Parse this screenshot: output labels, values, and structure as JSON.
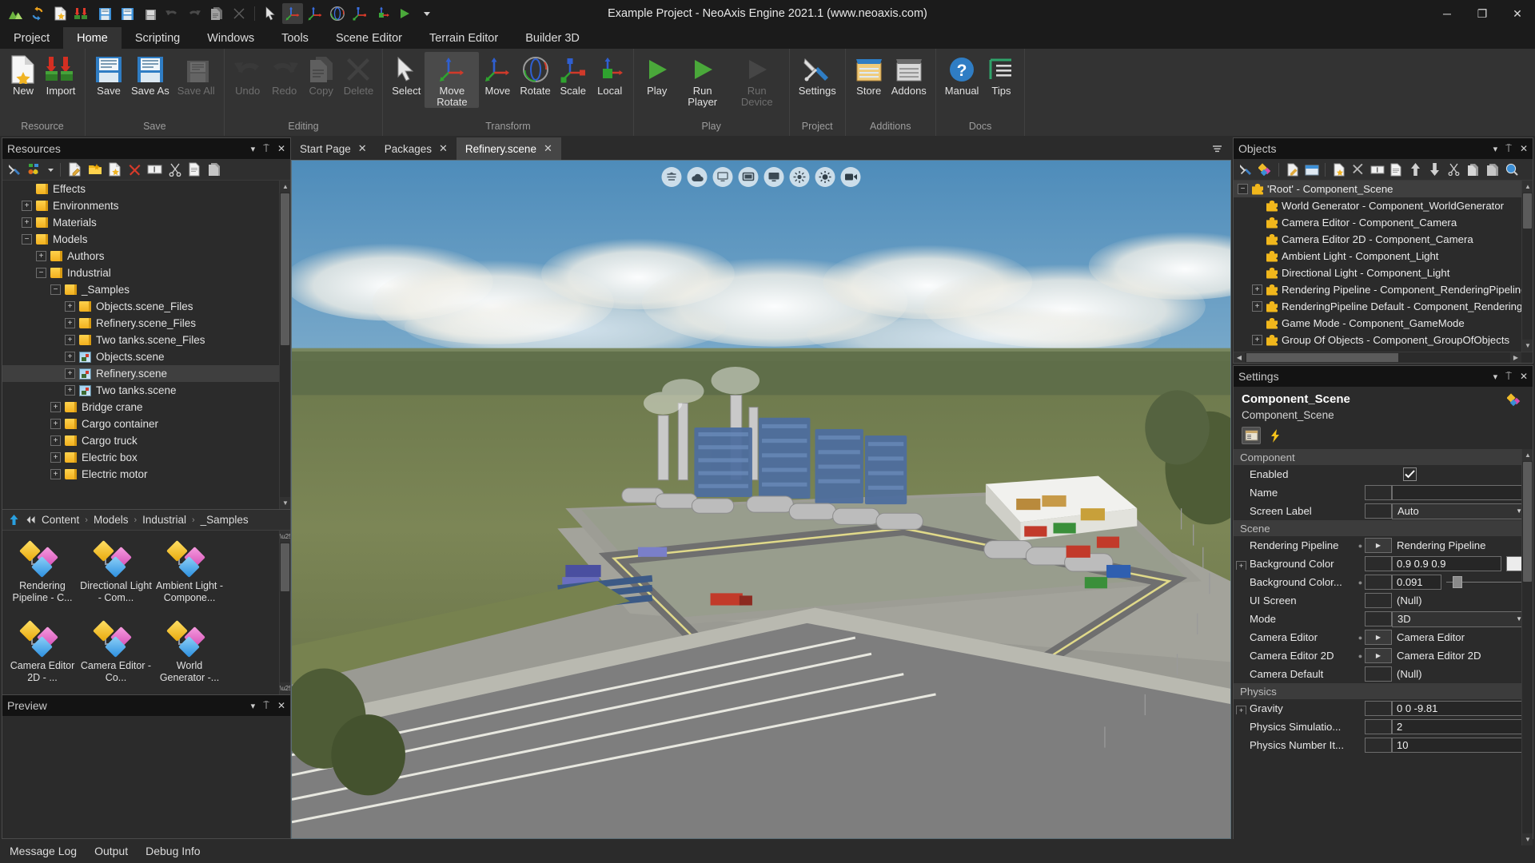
{
  "window": {
    "title": "Example Project - NeoAxis Engine 2021.1 (www.neoaxis.com)",
    "minimize": "─",
    "maximize": "❐",
    "close": "✕"
  },
  "quick_access": [
    {
      "name": "landscape-icon"
    },
    {
      "name": "refresh-icon"
    },
    {
      "name": "new-document-icon"
    },
    {
      "name": "import-icon"
    },
    {
      "name": "save-icon"
    },
    {
      "name": "save-as-icon"
    },
    {
      "name": "save-all-icon"
    },
    {
      "name": "undo-icon"
    },
    {
      "name": "redo-icon"
    },
    {
      "name": "copy-icon"
    },
    {
      "name": "delete-icon"
    },
    {
      "name": "select-cursor-icon"
    },
    {
      "name": "move-rotate-gizmo-icon"
    },
    {
      "name": "move-gizmo-icon"
    },
    {
      "name": "rotate-gizmo-icon"
    },
    {
      "name": "scale-gizmo-icon"
    },
    {
      "name": "local-gizmo-icon"
    },
    {
      "name": "play-icon"
    },
    {
      "name": "run-player-icon"
    },
    {
      "name": "wrench-icon"
    },
    {
      "name": "overflow-icon"
    }
  ],
  "ribbon": {
    "tabs": [
      {
        "label": "Project",
        "active": false
      },
      {
        "label": "Home",
        "active": true
      },
      {
        "label": "Scripting",
        "active": false
      },
      {
        "label": "Windows",
        "active": false
      },
      {
        "label": "Tools",
        "active": false
      },
      {
        "label": "Scene Editor",
        "active": false
      },
      {
        "label": "Terrain Editor",
        "active": false
      },
      {
        "label": "Builder 3D",
        "active": false
      }
    ],
    "groups": [
      {
        "label": "Resource",
        "items": [
          {
            "label": "New",
            "icon": "new-document-icon",
            "disabled": false,
            "selected": false
          },
          {
            "label": "Import",
            "icon": "import-icon",
            "disabled": false,
            "selected": false
          }
        ]
      },
      {
        "label": "Save",
        "items": [
          {
            "label": "Save",
            "icon": "save-icon",
            "disabled": false,
            "selected": false
          },
          {
            "label": "Save As",
            "icon": "save-as-icon",
            "disabled": false,
            "selected": false
          },
          {
            "label": "Save All",
            "icon": "save-all-icon",
            "disabled": true,
            "selected": false
          }
        ]
      },
      {
        "label": "Editing",
        "items": [
          {
            "label": "Undo",
            "icon": "undo-icon",
            "disabled": true,
            "selected": false
          },
          {
            "label": "Redo",
            "icon": "redo-icon",
            "disabled": true,
            "selected": false
          },
          {
            "label": "Copy",
            "icon": "copy-icon",
            "disabled": true,
            "selected": false
          },
          {
            "label": "Delete",
            "icon": "delete-icon",
            "disabled": true,
            "selected": false
          }
        ]
      },
      {
        "label": "Transform",
        "items": [
          {
            "label": "Select",
            "icon": "select-cursor-icon",
            "disabled": false,
            "selected": false
          },
          {
            "label": "Move Rotate",
            "icon": "move-rotate-gizmo-icon",
            "disabled": false,
            "selected": true
          },
          {
            "label": "Move",
            "icon": "move-gizmo-icon",
            "disabled": false,
            "selected": false
          },
          {
            "label": "Rotate",
            "icon": "rotate-gizmo-icon",
            "disabled": false,
            "selected": false
          },
          {
            "label": "Scale",
            "icon": "scale-gizmo-icon",
            "disabled": false,
            "selected": false
          },
          {
            "label": "Local",
            "icon": "local-gizmo-icon",
            "disabled": false,
            "selected": false
          }
        ]
      },
      {
        "label": "Play",
        "items": [
          {
            "label": "Play",
            "icon": "play-icon",
            "disabled": false,
            "selected": false
          },
          {
            "label": "Run Player",
            "icon": "run-player-icon",
            "disabled": false,
            "selected": false
          },
          {
            "label": "Run Device",
            "icon": "run-device-icon",
            "disabled": true,
            "selected": false
          }
        ]
      },
      {
        "label": "Project",
        "items": [
          {
            "label": "Settings",
            "icon": "wrench-icon",
            "disabled": false,
            "selected": false
          }
        ]
      },
      {
        "label": "Additions",
        "items": [
          {
            "label": "Store",
            "icon": "store-icon",
            "disabled": false,
            "selected": false
          },
          {
            "label": "Addons",
            "icon": "addons-icon",
            "disabled": false,
            "selected": false
          }
        ]
      },
      {
        "label": "Docs",
        "items": [
          {
            "label": "Manual",
            "icon": "help-icon",
            "disabled": false,
            "selected": false
          },
          {
            "label": "Tips",
            "icon": "tips-icon",
            "disabled": false,
            "selected": false
          }
        ]
      }
    ]
  },
  "resources_panel": {
    "title": "Resources",
    "toolbar": [
      {
        "name": "wrench-icon"
      },
      {
        "name": "filter-shapes-icon"
      },
      {
        "name": "dropdown-arrow-icon"
      },
      {
        "name": "edit-document-icon"
      },
      {
        "name": "new-folder-icon"
      },
      {
        "name": "new-resource-icon"
      },
      {
        "name": "delete-red-x-icon"
      },
      {
        "name": "rename-icon"
      },
      {
        "name": "cut-scissors-icon"
      },
      {
        "name": "copy-icon"
      },
      {
        "name": "paste-icon"
      }
    ],
    "tree": [
      {
        "label": "Effects",
        "indent": 1,
        "expander": "",
        "icon": "folder",
        "selected": false
      },
      {
        "label": "Environments",
        "indent": 1,
        "expander": "+",
        "icon": "folder",
        "selected": false
      },
      {
        "label": "Materials",
        "indent": 1,
        "expander": "+",
        "icon": "folder",
        "selected": false
      },
      {
        "label": "Models",
        "indent": 1,
        "expander": "−",
        "icon": "folder",
        "selected": false
      },
      {
        "label": "Authors",
        "indent": 2,
        "expander": "+",
        "icon": "folder",
        "selected": false
      },
      {
        "label": "Industrial",
        "indent": 2,
        "expander": "−",
        "icon": "folder",
        "selected": false
      },
      {
        "label": "_Samples",
        "indent": 3,
        "expander": "−",
        "icon": "folder",
        "selected": false
      },
      {
        "label": "Objects.scene_Files",
        "indent": 4,
        "expander": "+",
        "icon": "folder",
        "selected": false
      },
      {
        "label": "Refinery.scene_Files",
        "indent": 4,
        "expander": "+",
        "icon": "folder",
        "selected": false
      },
      {
        "label": "Two tanks.scene_Files",
        "indent": 4,
        "expander": "+",
        "icon": "folder",
        "selected": false
      },
      {
        "label": "Objects.scene",
        "indent": 4,
        "expander": "+",
        "icon": "scene",
        "selected": false
      },
      {
        "label": "Refinery.scene",
        "indent": 4,
        "expander": "+",
        "icon": "scene",
        "selected": true
      },
      {
        "label": "Two tanks.scene",
        "indent": 4,
        "expander": "+",
        "icon": "scene",
        "selected": false
      },
      {
        "label": "Bridge crane",
        "indent": 3,
        "expander": "+",
        "icon": "folder",
        "selected": false
      },
      {
        "label": "Cargo container",
        "indent": 3,
        "expander": "+",
        "icon": "folder",
        "selected": false
      },
      {
        "label": "Cargo truck",
        "indent": 3,
        "expander": "+",
        "icon": "folder",
        "selected": false
      },
      {
        "label": "Electric box",
        "indent": 3,
        "expander": "+",
        "icon": "folder",
        "selected": false
      },
      {
        "label": "Electric motor",
        "indent": 3,
        "expander": "+",
        "icon": "folder",
        "selected": false
      }
    ],
    "breadcrumb": {
      "up_icon": "up-arrow-icon",
      "back_icon": "back-double-arrow-icon",
      "items": [
        "Content",
        "Models",
        "Industrial",
        "_Samples"
      ]
    },
    "thumbnails": [
      {
        "label": "World Generator -...",
        "icon": "component-icon"
      },
      {
        "label": "Camera Editor - Co...",
        "icon": "component-icon"
      },
      {
        "label": "Camera Editor 2D - ...",
        "icon": "component-icon"
      },
      {
        "label": "Ambient Light - Compone...",
        "icon": "component-icon"
      },
      {
        "label": "Directional Light - Com...",
        "icon": "component-icon"
      },
      {
        "label": "Rendering Pipeline - C...",
        "icon": "component-icon"
      }
    ]
  },
  "preview_panel": {
    "title": "Preview"
  },
  "document_tabs": [
    {
      "label": "Start Page",
      "active": false,
      "close": "✕"
    },
    {
      "label": "Packages",
      "active": false,
      "close": "✕"
    },
    {
      "label": "Refinery.scene",
      "active": true,
      "close": "✕"
    }
  ],
  "viewport": {
    "overlay_icons": [
      {
        "name": "terrain-layers-icon"
      },
      {
        "name": "cloud-icon"
      },
      {
        "name": "monitor-small-icon"
      },
      {
        "name": "screen-icon"
      },
      {
        "name": "display-icon"
      },
      {
        "name": "sun-rays-icon"
      },
      {
        "name": "sun-bright-icon"
      },
      {
        "name": "camera-video-icon"
      }
    ]
  },
  "objects_panel": {
    "title": "Objects",
    "toolbar": [
      {
        "name": "wrench-icon"
      },
      {
        "name": "component-add-icon"
      },
      {
        "name": "edit-document-icon"
      },
      {
        "name": "new-window-icon"
      },
      {
        "name": "new-resource-icon"
      },
      {
        "name": "delete-x-icon"
      },
      {
        "name": "rename-icon"
      },
      {
        "name": "copy-icon"
      },
      {
        "name": "move-up-icon"
      },
      {
        "name": "move-down-icon"
      },
      {
        "name": "cut-scissors-icon"
      },
      {
        "name": "duplicate-icon"
      },
      {
        "name": "paste-icon"
      },
      {
        "name": "search-globe-icon"
      }
    ],
    "tree": [
      {
        "label": "'Root' - Component_Scene",
        "indent": 0,
        "expander": "−",
        "selected": true
      },
      {
        "label": "World Generator - Component_WorldGenerator",
        "indent": 1,
        "expander": "",
        "selected": false
      },
      {
        "label": "Camera Editor - Component_Camera",
        "indent": 1,
        "expander": "",
        "selected": false
      },
      {
        "label": "Camera Editor 2D - Component_Camera",
        "indent": 1,
        "expander": "",
        "selected": false
      },
      {
        "label": "Ambient Light - Component_Light",
        "indent": 1,
        "expander": "",
        "selected": false
      },
      {
        "label": "Directional Light - Component_Light",
        "indent": 1,
        "expander": "",
        "selected": false
      },
      {
        "label": "Rendering Pipeline - Component_RenderingPipeline",
        "indent": 1,
        "expander": "+",
        "selected": false
      },
      {
        "label": "RenderingPipeline Default - Component_Rendering",
        "indent": 1,
        "expander": "+",
        "selected": false
      },
      {
        "label": "Game Mode - Component_GameMode",
        "indent": 1,
        "expander": "",
        "selected": false
      },
      {
        "label": "Group Of Objects - Component_GroupOfObjects",
        "indent": 1,
        "expander": "+",
        "selected": false
      }
    ]
  },
  "settings_panel": {
    "title": "Settings",
    "header_title": "Component_Scene",
    "header_subtitle": "Component_Scene",
    "header_icon": "component-icon",
    "tool_buttons": [
      {
        "name": "properties-icon",
        "selected": true
      },
      {
        "name": "events-lightning-icon",
        "selected": false
      }
    ],
    "categories": [
      {
        "label": "Component",
        "rows": [
          {
            "name": "Enabled",
            "type": "checkbox",
            "value": true,
            "expander": false,
            "dot": false
          },
          {
            "name": "Name",
            "type": "text",
            "value": "",
            "expander": false,
            "dot": false
          },
          {
            "name": "Screen Label",
            "type": "combo",
            "value": "Auto",
            "expander": false,
            "dot": false,
            "box": true
          }
        ]
      },
      {
        "label": "Scene",
        "rows": [
          {
            "name": "Rendering Pipeline",
            "type": "reference",
            "value": "Rendering Pipeline",
            "expander": false,
            "dot": true
          },
          {
            "name": "Background Color",
            "type": "color",
            "value": "0.9 0.9 0.9",
            "swatch": "#ececec",
            "expander": true,
            "dot": false,
            "box": true
          },
          {
            "name": "Background Color...",
            "type": "slider",
            "value": "0.091",
            "expander": false,
            "dot": true,
            "box": true
          },
          {
            "name": "UI Screen",
            "type": "plain",
            "value": "(Null)",
            "expander": false,
            "dot": false,
            "box": true
          },
          {
            "name": "Mode",
            "type": "combo",
            "value": "3D",
            "expander": false,
            "dot": false,
            "box": true
          },
          {
            "name": "Camera Editor",
            "type": "reference",
            "value": "Camera Editor",
            "expander": false,
            "dot": true
          },
          {
            "name": "Camera Editor 2D",
            "type": "reference",
            "value": "Camera Editor 2D",
            "expander": false,
            "dot": true
          },
          {
            "name": "Camera Default",
            "type": "plain",
            "value": "(Null)",
            "expander": false,
            "dot": false,
            "box": true
          }
        ]
      },
      {
        "label": "Physics",
        "rows": [
          {
            "name": "Gravity",
            "type": "text",
            "value": "0 0 -9.81",
            "expander": true,
            "dot": false,
            "box": true
          },
          {
            "name": "Physics Simulatio...",
            "type": "text",
            "value": "2",
            "expander": false,
            "dot": false,
            "box": true
          },
          {
            "name": "Physics Number It...",
            "type": "text",
            "value": "10",
            "expander": false,
            "dot": false,
            "box": true
          }
        ]
      }
    ]
  },
  "status_bar": {
    "items": [
      "Message Log",
      "Output",
      "Debug Info"
    ]
  },
  "panel_buttons": {
    "dropdown": "▾",
    "pin": "⍑",
    "close": "✕"
  }
}
